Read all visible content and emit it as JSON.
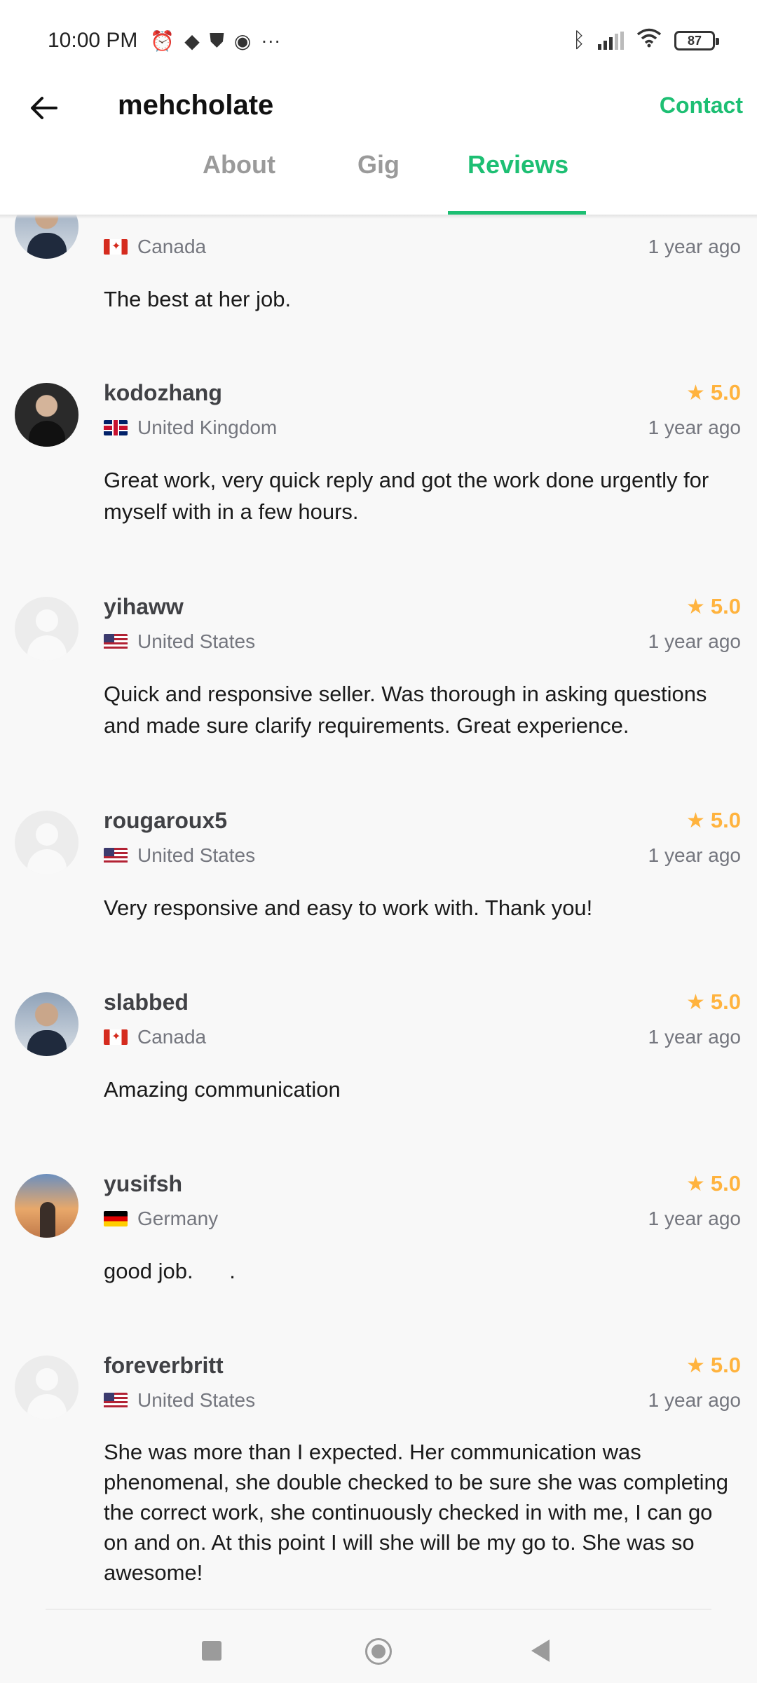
{
  "status_bar": {
    "time": "10:00 PM",
    "more": "···",
    "battery": "87",
    "icons": [
      "alarm-icon",
      "game-icon",
      "shield-icon",
      "app-icon",
      "bluetooth-icon",
      "signal-icon",
      "wifi-icon",
      "battery-icon"
    ]
  },
  "header": {
    "title": "mehcholate",
    "contact": "Contact",
    "back_icon": "arrow-left-icon"
  },
  "tabs": [
    {
      "label": "About",
      "active": false
    },
    {
      "label": "Gig",
      "active": false
    },
    {
      "label": "Reviews",
      "active": true
    }
  ],
  "reviews": [
    {
      "username": "",
      "country": "Canada",
      "flag": "ca",
      "rating": "",
      "time": "1 year ago",
      "text": "The best at her job.",
      "avatar": "photo"
    },
    {
      "username": "kodozhang",
      "country": "United Kingdom",
      "flag": "uk",
      "rating": "5.0",
      "time": "1 year ago",
      "text": "Great work, very quick reply and got the work done urgently for myself with in a few hours.",
      "avatar": "photo"
    },
    {
      "username": "yihaww",
      "country": "United States",
      "flag": "us",
      "rating": "5.0",
      "time": "1 year ago",
      "text": "Quick and responsive seller. Was thorough in asking questions and made sure clarify requirements. Great experience.",
      "avatar": "placeholder"
    },
    {
      "username": "rougaroux5",
      "country": "United States",
      "flag": "us",
      "rating": "5.0",
      "time": "1 year ago",
      "text": "Very responsive and easy to work with. Thank you!",
      "avatar": "placeholder"
    },
    {
      "username": "slabbed",
      "country": "Canada",
      "flag": "ca",
      "rating": "5.0",
      "time": "1 year ago",
      "text": "Amazing communication",
      "avatar": "photo"
    },
    {
      "username": "yusifsh",
      "country": "Germany",
      "flag": "de",
      "rating": "5.0",
      "time": "1 year ago",
      "text": "good job.      .",
      "avatar": "photo"
    },
    {
      "username": "foreverbritt",
      "country": "United States",
      "flag": "us",
      "rating": "5.0",
      "time": "1 year ago",
      "text": "She was more than I expected. Her communication was phenomenal, she double checked to be sure she was completing the correct work, she continuously checked in with me,  I can go on and on. At this point I will she will be my go to. She was so awesome!",
      "avatar": "placeholder"
    }
  ],
  "colors": {
    "accent": "#1dbf73",
    "star": "#ffb33e",
    "muted": "#74767e"
  },
  "nav": {
    "icons": [
      "recents-square-icon",
      "home-circle-icon",
      "back-triangle-icon"
    ]
  }
}
